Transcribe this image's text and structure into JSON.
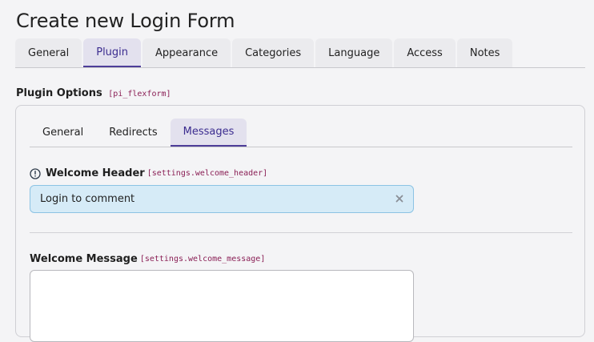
{
  "page": {
    "title": "Create new Login Form"
  },
  "main_tabs": [
    {
      "label": "General"
    },
    {
      "label": "Plugin"
    },
    {
      "label": "Appearance"
    },
    {
      "label": "Categories"
    },
    {
      "label": "Language"
    },
    {
      "label": "Access"
    },
    {
      "label": "Notes"
    }
  ],
  "main_tabs_active": "Plugin",
  "plugin_options": {
    "label": "Plugin Options",
    "key": "[pi_flexform]"
  },
  "sub_tabs": [
    {
      "label": "General"
    },
    {
      "label": "Redirects"
    },
    {
      "label": "Messages"
    }
  ],
  "sub_tabs_active": "Messages",
  "welcome_header": {
    "label": "Welcome Header",
    "key": "[settings.welcome_header]",
    "value": "Login to comment",
    "icon": "info-circle-icon"
  },
  "welcome_message": {
    "label": "Welcome Message",
    "key": "[settings.welcome_message]",
    "value": ""
  },
  "colors": {
    "accent": "#4d3d99",
    "active_tab_bg": "#e3e1ee",
    "input_bg": "#d6ebf7",
    "input_border": "#8cc3e4",
    "code_key": "#8a1f55"
  }
}
